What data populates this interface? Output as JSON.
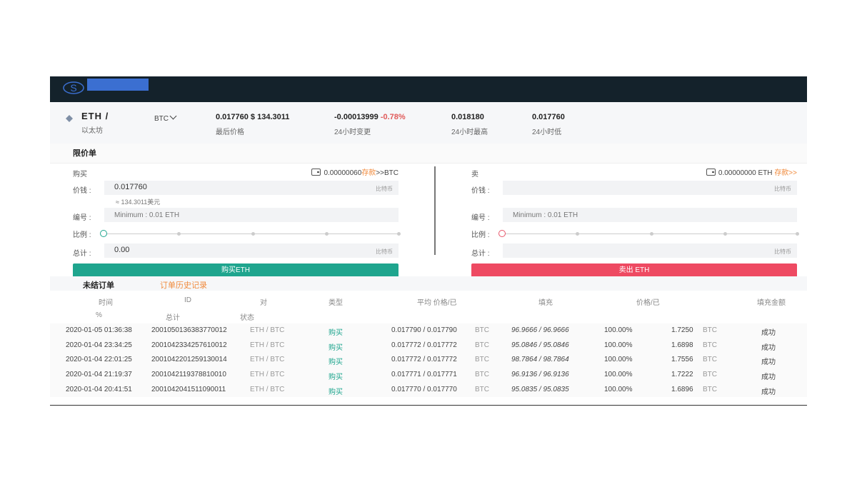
{
  "header": {
    "logo_icon": "exchange-logo-icon",
    "brand_redacted": true
  },
  "ticker": {
    "base": "ETH /",
    "base_name": "以太坊",
    "quote": "BTC",
    "quote_dropdown_icon": "chevron-down-icon",
    "last_price": "0.017760 $ 134.3011",
    "last_price_label": "最后价格",
    "change_abs": "-0.00013999",
    "change_pct": "-0.78%",
    "change_label": "24小时变更",
    "high": "0.018180",
    "high_label": "24小时最高",
    "low": "0.017760",
    "low_label": "24小时低"
  },
  "limit_order": {
    "title": "限价单",
    "buy": {
      "title": "购买",
      "balance": "0.00000060",
      "deposit_link": "存款",
      "balance_suffix": ">>BTC",
      "price_label": "价钱 :",
      "price_value": "0.017760",
      "price_unit": "比特币",
      "approx": "≈ 134.3011美元",
      "amount_label": "编号 :",
      "amount_placeholder": "Minimum : 0.01 ETH",
      "ratio_label": "比例 :",
      "ratio_value": 0,
      "total_label": "总计 :",
      "total_value": "0.00",
      "total_unit": "比特币",
      "button": "购买ETH"
    },
    "sell": {
      "title": "卖",
      "balance": "0.00000000 ETH",
      "deposit_link": "存款>>",
      "price_label": "价钱 :",
      "price_value": "",
      "price_unit": "比特币",
      "amount_label": "编号 :",
      "amount_placeholder": "Minimum : 0.01 ETH",
      "ratio_label": "比例 :",
      "ratio_value": 0,
      "total_label": "总计 :",
      "total_value": "",
      "total_unit": "比特币",
      "button": "卖出 ETH"
    }
  },
  "orders": {
    "tabs": [
      "未结订单",
      "订单历史记录"
    ],
    "active_tab": 0,
    "columns": [
      "时间",
      "ID",
      "对",
      "类型",
      "平均 价格/已",
      "填充",
      "价格/已",
      "填充金额",
      "%",
      "总计",
      "状态"
    ],
    "rows": [
      {
        "time": "2020-01-05 01:36:38",
        "id": "2001050136383770012",
        "pair": "ETH / BTC",
        "type": "购买",
        "avg": "0.017790 / 0.017790",
        "avg_unit": "BTC",
        "filled": "96.9666 / 96.9666",
        "pct": "100.00%",
        "total": "1.7250",
        "total_unit": "BTC",
        "status": "成功"
      },
      {
        "time": "2020-01-04 23:34:25",
        "id": "2001042334257610012",
        "pair": "ETH / BTC",
        "type": "购买",
        "avg": "0.017772 / 0.017772",
        "avg_unit": "BTC",
        "filled": "95.0846 / 95.0846",
        "pct": "100.00%",
        "total": "1.6898",
        "total_unit": "BTC",
        "status": "成功"
      },
      {
        "time": "2020-01-04 22:01:25",
        "id": "2001042201259130014",
        "pair": "ETH / BTC",
        "type": "购买",
        "avg": "0.017772 / 0.017772",
        "avg_unit": "BTC",
        "filled": "98.7864 / 98.7864",
        "pct": "100.00%",
        "total": "1.7556",
        "total_unit": "BTC",
        "status": "成功"
      },
      {
        "time": "2020-01-04 21:19:37",
        "id": "2001042119378810010",
        "pair": "ETH / BTC",
        "type": "购买",
        "avg": "0.017771 / 0.017771",
        "avg_unit": "BTC",
        "filled": "96.9136 / 96.9136",
        "pct": "100.00%",
        "total": "1.7222",
        "total_unit": "BTC",
        "status": "成功"
      },
      {
        "time": "2020-01-04 20:41:51",
        "id": "2001042041511090011",
        "pair": "ETH / BTC",
        "type": "购买",
        "avg": "0.017770 / 0.017770",
        "avg_unit": "BTC",
        "filled": "95.0835 / 95.0835",
        "pct": "100.00%",
        "total": "1.6896",
        "total_unit": "BTC",
        "status": "成功"
      }
    ]
  },
  "colors": {
    "topbar": "#14222b",
    "buy": "#1fa58e",
    "sell": "#ee4a62",
    "negative": "#e05a5a",
    "accent_orange": "#f08a3c"
  }
}
